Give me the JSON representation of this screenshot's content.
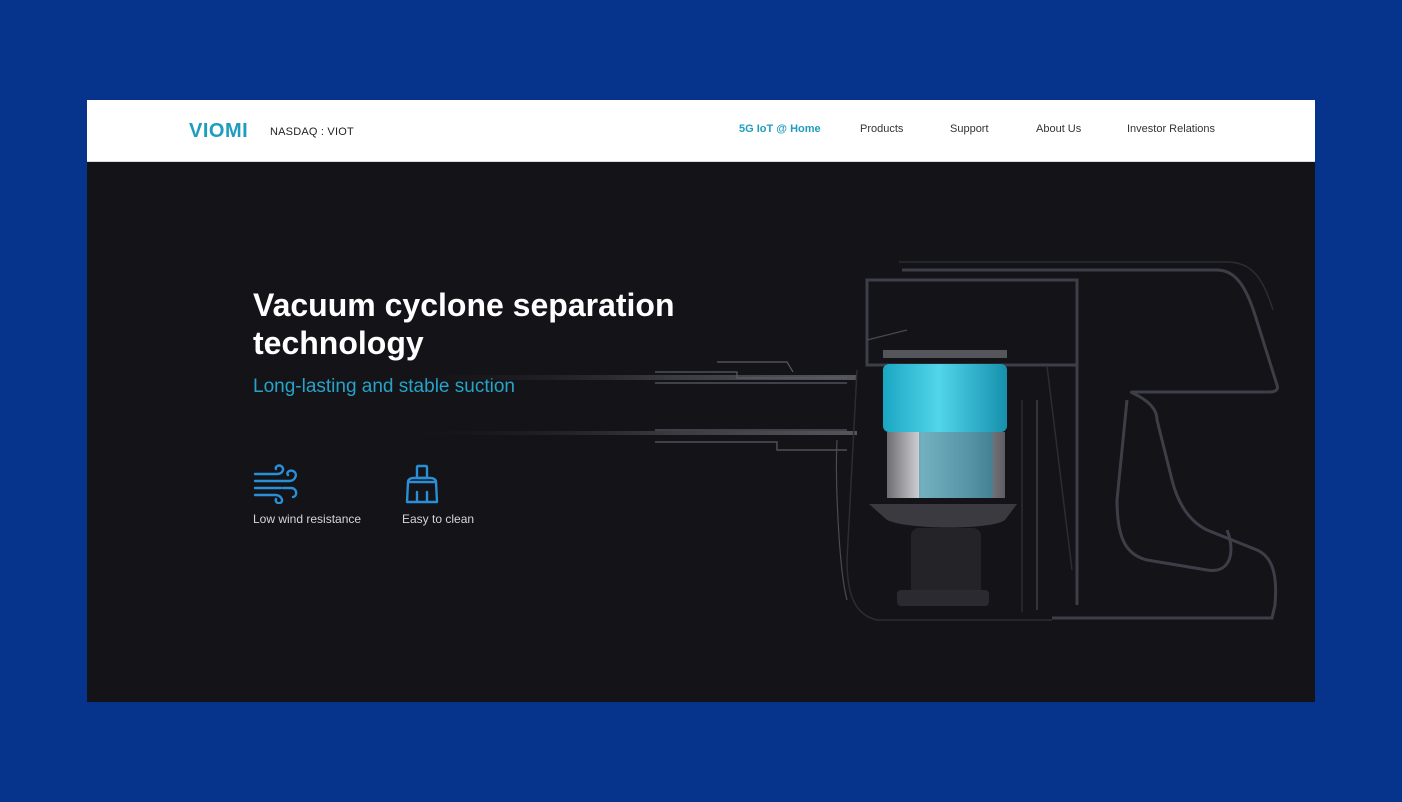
{
  "header": {
    "logo_text": "VIOMI",
    "ticker": "NASDAQ : VIOT",
    "nav": [
      {
        "label": "5G IoT @ Home",
        "active": true
      },
      {
        "label": "Products",
        "active": false
      },
      {
        "label": "Support",
        "active": false
      },
      {
        "label": "About Us",
        "active": false
      },
      {
        "label": "Investor Relations",
        "active": false
      }
    ]
  },
  "hero": {
    "title": "Vacuum cyclone separation technology",
    "subtitle": "Long-lasting and stable suction",
    "features": [
      {
        "icon": "wind-icon",
        "label": "Low wind resistance"
      },
      {
        "icon": "brush-icon",
        "label": "Easy to clean"
      }
    ]
  },
  "colors": {
    "page_background": "#06338b",
    "hero_background": "#131318",
    "accent": "#1f9dbf",
    "subtitle": "#27a3c7",
    "icon": "#2a8fd6"
  }
}
